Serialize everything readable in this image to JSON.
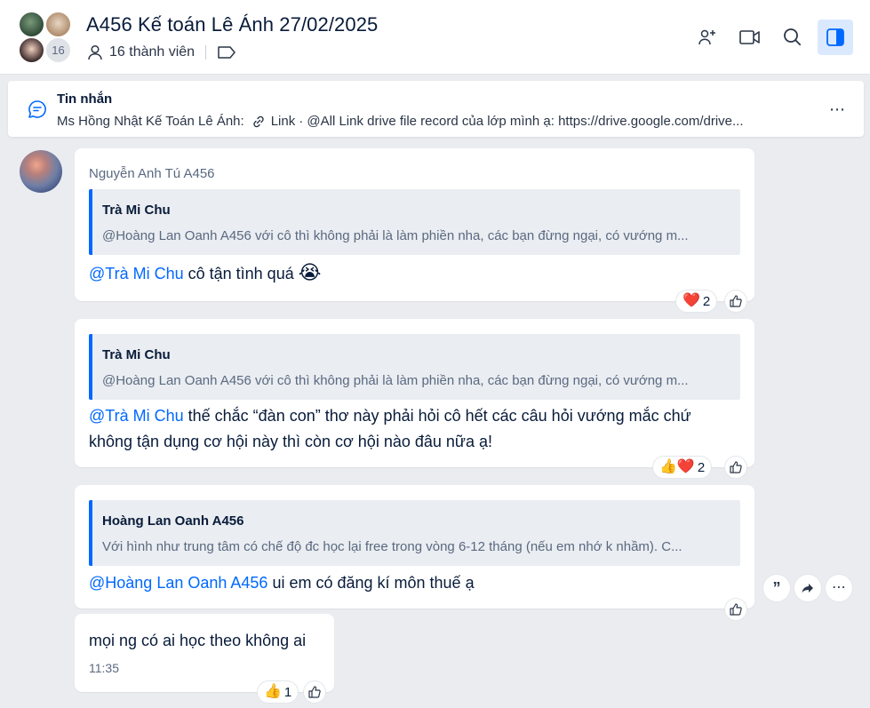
{
  "header": {
    "title": "A456 Kế toán Lê Ánh 27/02/2025",
    "members": "16 thành viên",
    "avatar_count": "16"
  },
  "pinned": {
    "label": "Tin nhắn",
    "sender": "Ms Hồng Nhật Kế Toán Lê Ánh:",
    "link_label": "Link",
    "text": "· @All Link drive file record của lớp mình ạ: https://drive.google.com/drive..."
  },
  "messages": [
    {
      "sender": "Nguyễn Anh Tú A456",
      "quote_name": "Trà Mi Chu",
      "quote_text": "@Hoàng Lan Oanh A456 với cô thì không phải là làm phiền nha, các bạn đừng ngại, có vướng m...",
      "mention": "@Trà Mi Chu",
      "text": " cô tận tình quá",
      "emoji": "😭",
      "reactions": [
        {
          "emoji": "❤️",
          "count": "2"
        }
      ]
    },
    {
      "quote_name": "Trà Mi Chu",
      "quote_text": "@Hoàng Lan Oanh A456 với cô thì không phải là làm phiền nha, các bạn đừng ngại, có vướng m...",
      "mention": "@Trà Mi Chu",
      "text_line1": " thế chắc “đàn con” thơ này phải hỏi cô hết các câu hỏi vướng mắc chứ",
      "text_line2": "không tận dụng cơ hội này thì còn cơ hội nào đâu nữa ạ!",
      "reactions": [
        {
          "emoji": "👍❤️",
          "count": "2"
        }
      ]
    },
    {
      "quote_name": "Hoàng Lan Oanh A456",
      "quote_text": "Với hình như trung tâm có chế độ đc học lại free trong vòng 6-12 tháng (nếu em nhớ k nhầm). C...",
      "mention": "@Hoàng Lan Oanh A456",
      "text": " ui em có đăng kí môn thuế ạ"
    },
    {
      "text": "mọi ng có ai học theo không ai",
      "time": "11:35",
      "reactions": [
        {
          "emoji": "👍",
          "count": "1"
        }
      ]
    }
  ]
}
